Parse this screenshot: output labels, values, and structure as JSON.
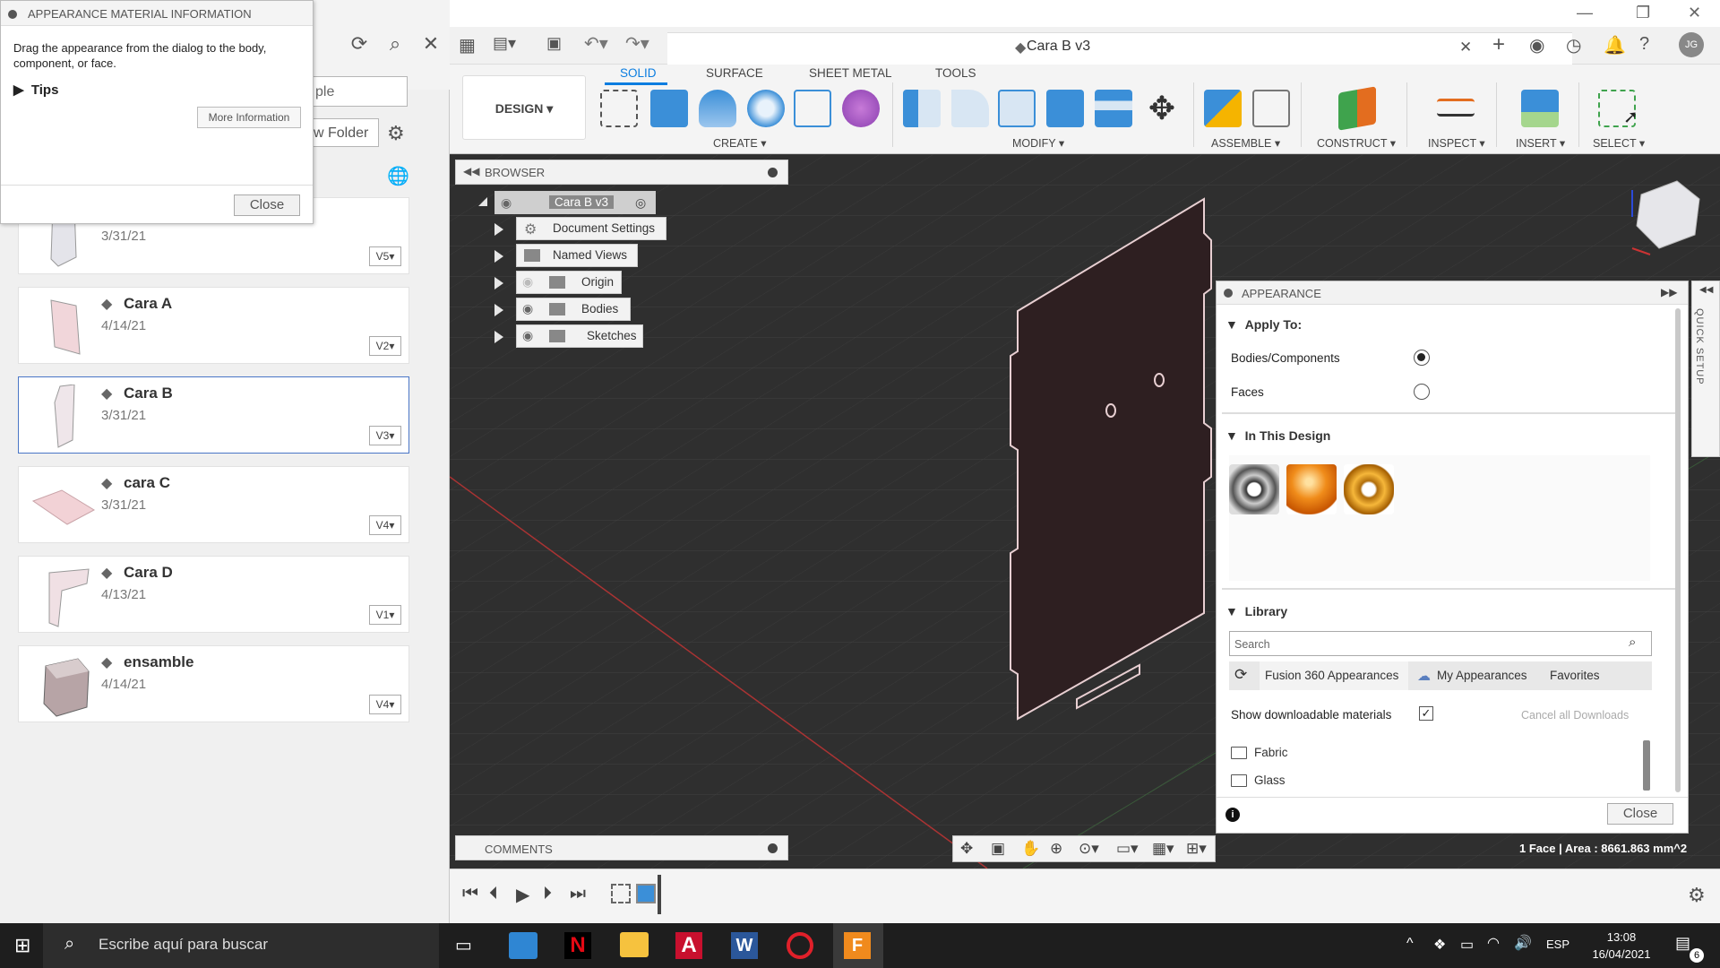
{
  "window": {
    "title": "Cara B v3"
  },
  "dialog": {
    "title": "APPEARANCE MATERIAL INFORMATION",
    "text": "Drag the appearance from the dialog to the body, component, or face.",
    "tips": "Tips",
    "more_info": "More Information",
    "close": "Close"
  },
  "left_panel": {
    "search_partial": "ple",
    "folder_partial": "w Folder",
    "cards": [
      {
        "name": "",
        "date": "3/31/21",
        "version": "V5"
      },
      {
        "name": "Cara A",
        "date": "4/14/21",
        "version": "V2"
      },
      {
        "name": "Cara B",
        "date": "3/31/21",
        "version": "V3"
      },
      {
        "name": "cara C",
        "date": "3/31/21",
        "version": "V4"
      },
      {
        "name": "Cara D",
        "date": "4/13/21",
        "version": "V1"
      },
      {
        "name": "ensamble",
        "date": "4/14/21",
        "version": "V4"
      }
    ]
  },
  "toolbar": {
    "design": "DESIGN ▾",
    "tabs": [
      "SOLID",
      "SURFACE",
      "SHEET METAL",
      "TOOLS"
    ],
    "groups": [
      "CREATE ▾",
      "MODIFY ▾",
      "ASSEMBLE ▾",
      "CONSTRUCT ▾",
      "INSPECT ▾",
      "INSERT ▾",
      "SELECT ▾"
    ]
  },
  "browser": {
    "title": "BROWSER",
    "root": "Cara B v3",
    "items": [
      "Document Settings",
      "Named Views",
      "Origin",
      "Bodies",
      "Sketches"
    ]
  },
  "comments": {
    "title": "COMMENTS"
  },
  "status": {
    "info": "1 Face | Area : 8661.863 mm^2"
  },
  "appearance": {
    "title": "APPEARANCE",
    "apply_to": "Apply To:",
    "bodies": "Bodies/Components",
    "faces": "Faces",
    "in_design": "In This Design",
    "library": "Library",
    "search_placeholder": "Search",
    "lib_tabs": [
      "Fusion 360 Appearances",
      "My Appearances",
      "Favorites"
    ],
    "show_downloadable": "Show downloadable materials",
    "cancel_downloads": "Cancel all Downloads",
    "folders": [
      "Fabric",
      "Glass"
    ],
    "close": "Close"
  },
  "quick_setup": "QUICK SETUP",
  "taskbar": {
    "search": "Escribe aquí para buscar",
    "lang": "ESP",
    "time": "13:08",
    "date": "16/04/2021",
    "notifications": "6"
  },
  "colors": {
    "accent": "#0a7de0",
    "viewport": "#2f2f2f",
    "taskbar": "#1e1e1e"
  }
}
